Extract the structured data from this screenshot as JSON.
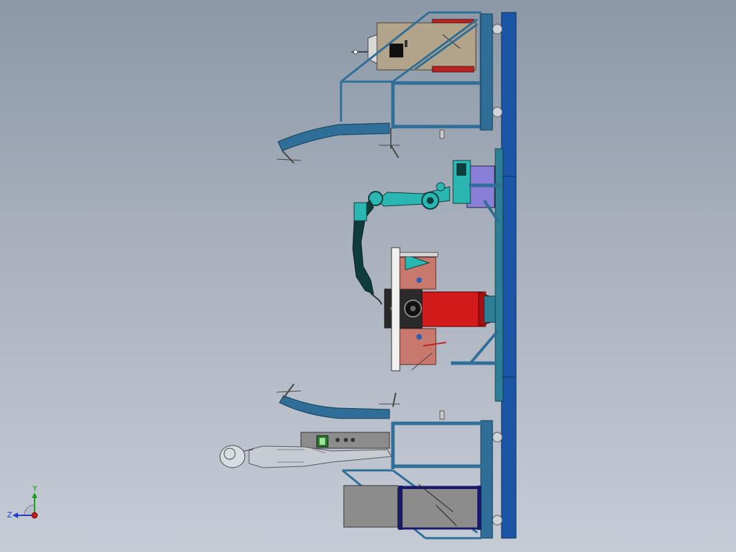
{
  "viewport": {
    "background_top": "#8c98a7",
    "background_bottom": "#c6ccd6"
  },
  "colors": {
    "frame_blue": "#2e6e97",
    "base_blue": "#1a55a6",
    "base_teal": "#2c7f94",
    "positioner_red": "#d21a1a",
    "robot_cyan": "#2ab7b2",
    "robot_dark": "#0f3c3c",
    "cabinet_tan": "#b2a48a",
    "cabinet_grey": "#8c8c8c",
    "fixture_salmon": "#c9786d"
  },
  "triad": {
    "y_label": "Y",
    "z_label": "Z",
    "y_color": "#1a9e1a",
    "z_color": "#1a3ec7",
    "origin_color": "#c71a1a"
  }
}
